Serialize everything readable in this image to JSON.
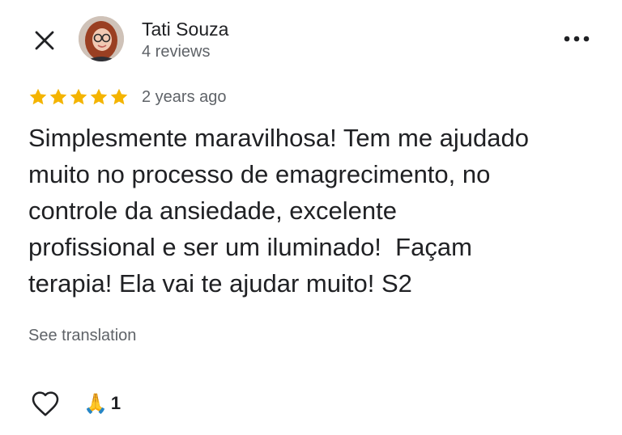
{
  "header": {
    "close_icon": "close-icon",
    "author_name": "Tati Souza",
    "author_reviews": "4 reviews",
    "more_icon": "more-horizontal-icon"
  },
  "review": {
    "rating": 5,
    "rating_max": 5,
    "date": "2 years ago",
    "text": "Simplesmente maravilhosa! Tem me ajudado\nmuito no processo de emagrecimento, no\ncontrole da ansiedade, excelente\nprofissional e ser um iluminado!  Façam\nterapia! Ela vai te ajudar muito! S2",
    "see_translation": "See translation"
  },
  "reactions": {
    "like_icon": "heart-outline-icon",
    "emoji": "🙏",
    "count": "1"
  },
  "colors": {
    "star": "#f4b400",
    "secondary_text": "#5f6368",
    "primary_text": "#202124"
  }
}
